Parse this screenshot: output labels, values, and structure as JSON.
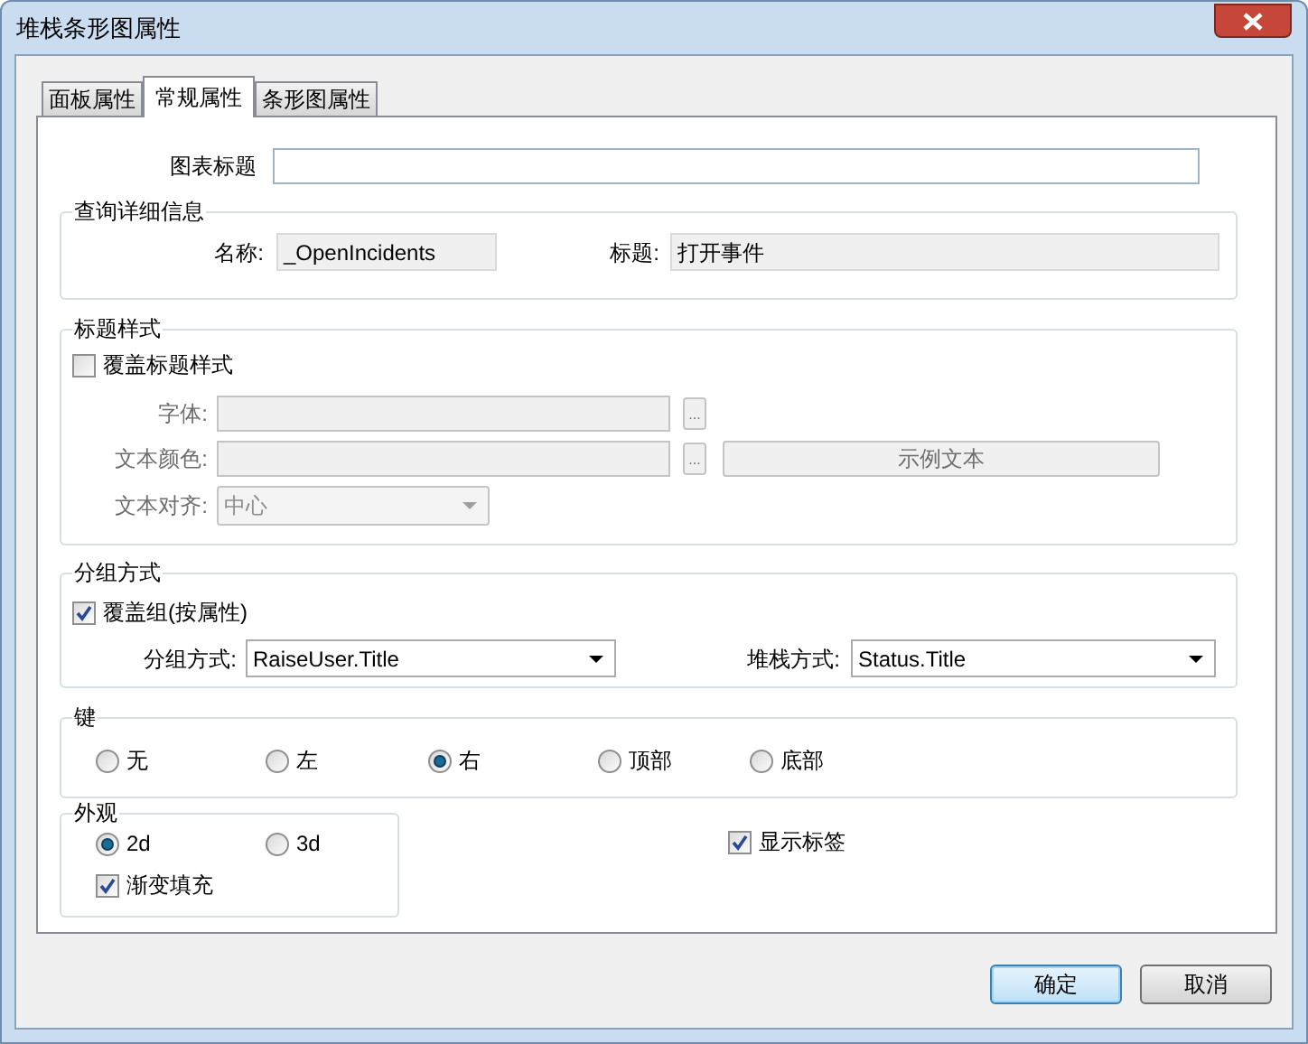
{
  "window": {
    "title": "堆栈条形图属性"
  },
  "tabs": [
    {
      "label": "面板属性",
      "selected": false
    },
    {
      "label": "常规属性",
      "selected": true
    },
    {
      "label": "条形图属性",
      "selected": false
    }
  ],
  "chart_title": {
    "label": "图表标题"
  },
  "query_details": {
    "legend": "查询详细信息",
    "name_label": "名称:",
    "name_value": "_OpenIncidents",
    "title_label": "标题:",
    "title_value": "打开事件"
  },
  "title_style": {
    "legend": "标题样式",
    "override": {
      "label": "覆盖标题样式",
      "checked": false
    },
    "disabled": true,
    "font_label": "字体:",
    "font_browse": "...",
    "color_label": "文本颜色:",
    "color_browse": "...",
    "sample": "示例文本",
    "align_label": "文本对齐:",
    "align_value": "中心"
  },
  "grouping": {
    "legend": "分组方式",
    "override": {
      "label": "覆盖组(按属性)",
      "checked": true
    },
    "group_by_label": "分组方式:",
    "group_by_value": "RaiseUser.Title",
    "stack_by_label": "堆栈方式:",
    "stack_by_value": "Status.Title"
  },
  "legend_position": {
    "legend": "键",
    "options": [
      {
        "label": "无",
        "selected": false
      },
      {
        "label": "左",
        "selected": false
      },
      {
        "label": "右",
        "selected": true
      },
      {
        "label": "顶部",
        "selected": false
      },
      {
        "label": "底部",
        "selected": false
      }
    ]
  },
  "appearance": {
    "legend": "外观",
    "options": [
      {
        "label": "2d",
        "selected": true
      },
      {
        "label": "3d",
        "selected": false
      }
    ],
    "gradient": {
      "label": "渐变填充",
      "checked": true
    }
  },
  "show_labels": {
    "label": "显示标签",
    "checked": true
  },
  "buttons": [
    {
      "label": "确定",
      "default": true
    },
    {
      "label": "取消",
      "default": false
    }
  ]
}
